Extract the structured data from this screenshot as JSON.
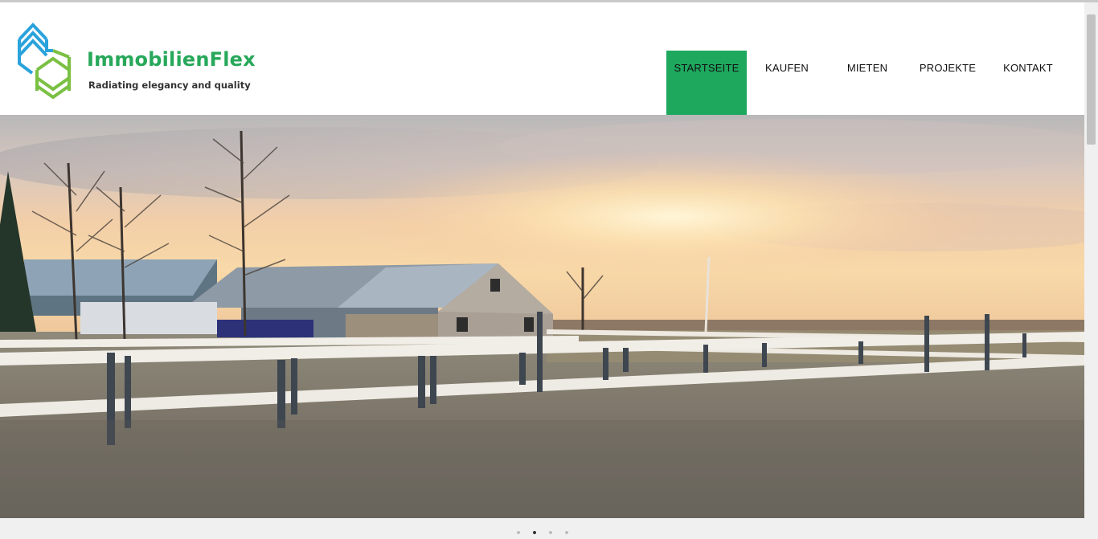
{
  "brand": {
    "name": "ImmobilienFlex",
    "tagline": "Radiating elegancy and quality"
  },
  "nav": {
    "items": [
      {
        "label": "STARTSEITE",
        "active": true
      },
      {
        "label": "KAUFEN",
        "active": false
      },
      {
        "label": "MIETEN",
        "active": false
      },
      {
        "label": "PROJEKTE",
        "active": false
      },
      {
        "label": "KONTAKT",
        "active": false
      }
    ]
  },
  "slider": {
    "slide_count": 4,
    "active_slide": 2
  },
  "colors": {
    "accent": "#1ea85e",
    "logo_blue": "#2aa3dc",
    "logo_green": "#7ac043"
  }
}
